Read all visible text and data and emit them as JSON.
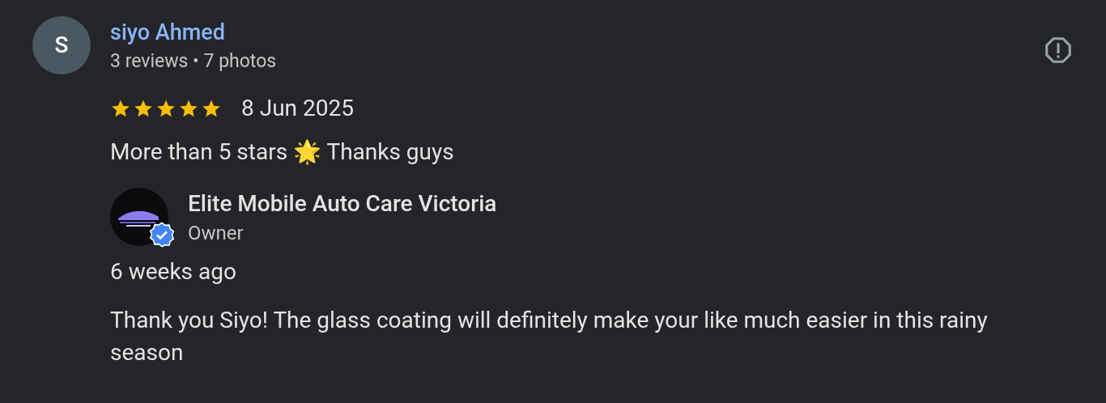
{
  "review": {
    "avatar_letter": "S",
    "author": "siyo Ahmed",
    "meta": "3 reviews • 7 photos",
    "stars": 5,
    "date": "8 Jun 2025",
    "text": "More than 5 stars 🌟 Thanks guys"
  },
  "owner_reply": {
    "name": "Elite Mobile Auto Care Victoria",
    "role": "Owner",
    "verified": true,
    "time": "6 weeks ago",
    "text": "Thank you Siyo! The glass coating will definitely make your like much easier in this rainy season"
  }
}
